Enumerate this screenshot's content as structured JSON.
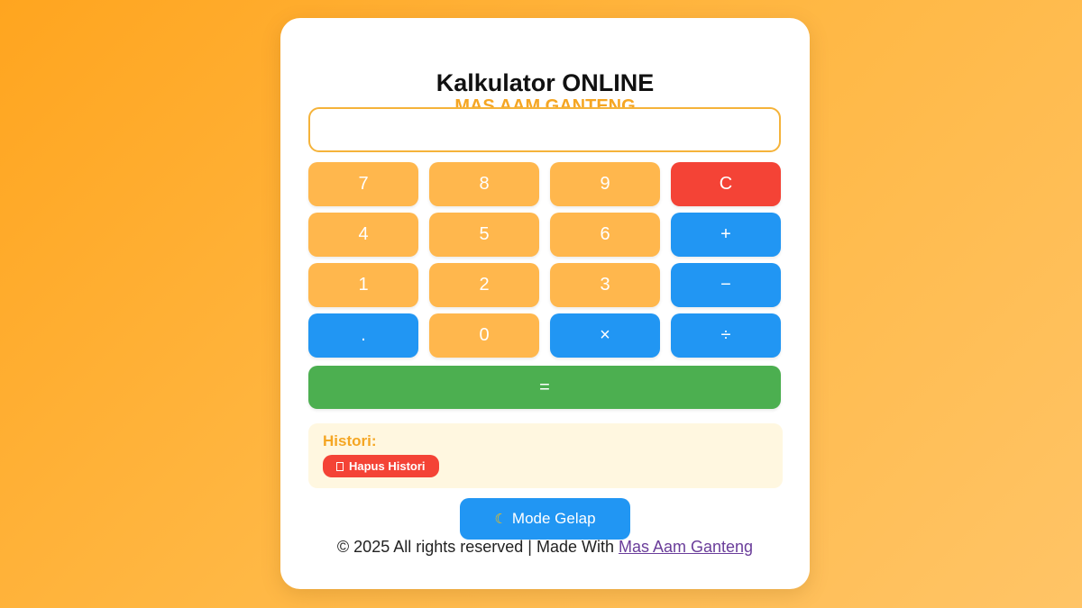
{
  "header": {
    "title": "Kalkulator ONLINE",
    "subtitle": "MAS AAM GANTENG"
  },
  "display": {
    "value": "",
    "placeholder": ""
  },
  "keys": [
    {
      "label": "7",
      "kind": "num"
    },
    {
      "label": "8",
      "kind": "num"
    },
    {
      "label": "9",
      "kind": "num"
    },
    {
      "label": "C",
      "kind": "clear"
    },
    {
      "label": "4",
      "kind": "num"
    },
    {
      "label": "5",
      "kind": "num"
    },
    {
      "label": "6",
      "kind": "num"
    },
    {
      "label": "+",
      "kind": "op"
    },
    {
      "label": "1",
      "kind": "num"
    },
    {
      "label": "2",
      "kind": "num"
    },
    {
      "label": "3",
      "kind": "num"
    },
    {
      "label": "−",
      "kind": "op"
    },
    {
      "label": ".",
      "kind": "op"
    },
    {
      "label": "0",
      "kind": "num"
    },
    {
      "label": "×",
      "kind": "op"
    },
    {
      "label": "÷",
      "kind": "op"
    },
    {
      "label": "=",
      "kind": "equals"
    }
  ],
  "history": {
    "title": "Histori:",
    "clear_label": "Hapus Histori",
    "clear_icon": "trash-icon"
  },
  "mode_button": {
    "icon": "moon-icon",
    "label": "Mode Gelap"
  },
  "footer": {
    "text": "© 2025 All rights reserved | Made With ",
    "link_label": "Mas Aam Ganteng"
  },
  "colors": {
    "accent": "#f5a623",
    "number_key": "#ffb74d",
    "operator_key": "#2196f3",
    "clear_key": "#f44336",
    "equals_key": "#4caf50",
    "history_bg": "#fff7e0"
  }
}
